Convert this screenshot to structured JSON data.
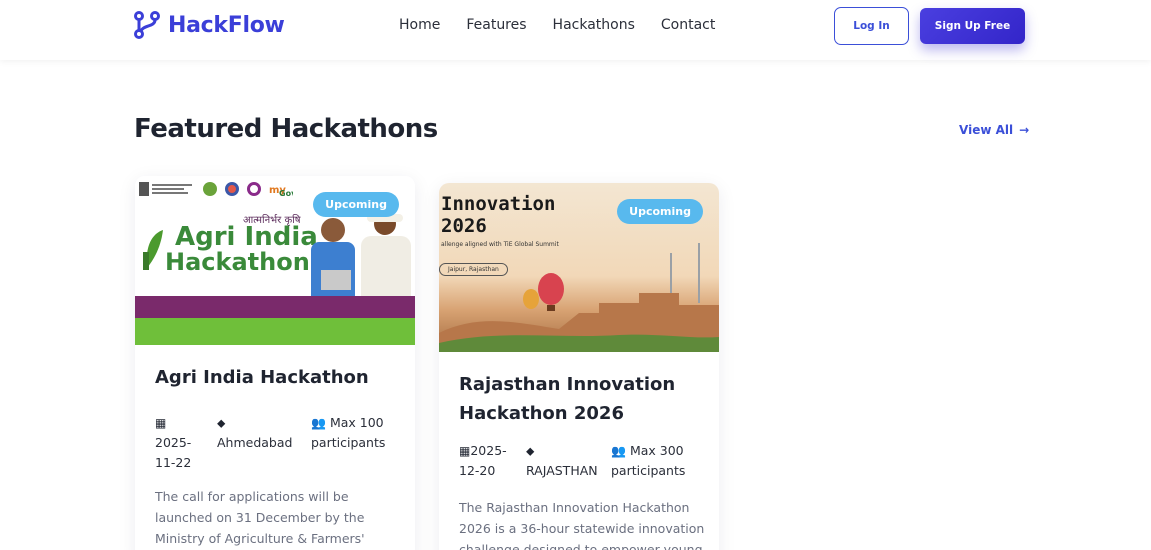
{
  "navbar": {
    "brand": "HackFlow",
    "links": [
      "Home",
      "Features",
      "Hackathons",
      "Contact"
    ],
    "login_label": "Log In",
    "signup_label": "Sign Up Free"
  },
  "section": {
    "title": "Featured Hackathons",
    "view_all_label": "View All",
    "view_all_arrow": "→"
  },
  "cards": [
    {
      "badge": "Upcoming",
      "image_text": {
        "title_line1": "Agri India",
        "title_line2": "Hackathon",
        "hindi": "आत्मनिर्भर कृषि"
      },
      "title": "Agri India Hackathon",
      "date": "2025-11-22",
      "date_line1": "2025-",
      "date_line2": "11-22",
      "location": "Ahmedabad",
      "participants_line1": "Max 100",
      "participants_line2": "participants",
      "description_lines": [
        "The call for applications will be",
        "launched on 31 December by the",
        "Ministry of Agriculture & Farmers'"
      ]
    },
    {
      "badge": "Upcoming",
      "image_text": {
        "title_line1": "Innovation",
        "title_line2": "2026",
        "subtitle": "allenge aligned with TiE Global Summit",
        "pill": "Jaipur, Rajasthan"
      },
      "title_line1": "Rajasthan Innovation",
      "title_line2": "Hackathon 2026",
      "date_line1": "2025-",
      "date_line2": "12-20",
      "location": "RAJASTHAN",
      "participants_line1": "Max 300",
      "participants_line2": "participants",
      "description_lines": [
        "The Rajasthan Innovation Hackathon",
        "2026 is a 36-hour statewide innovation",
        "challenge designed to empower young"
      ]
    }
  ],
  "icons": {
    "calendar": "calendar-icon",
    "location": "map-pin-icon",
    "participants": "users-icon"
  },
  "colors": {
    "brand": "#3b3fd8",
    "primary_button": "#3b2fd6",
    "badge": "#58b9ee",
    "link": "#3b4fd8"
  }
}
